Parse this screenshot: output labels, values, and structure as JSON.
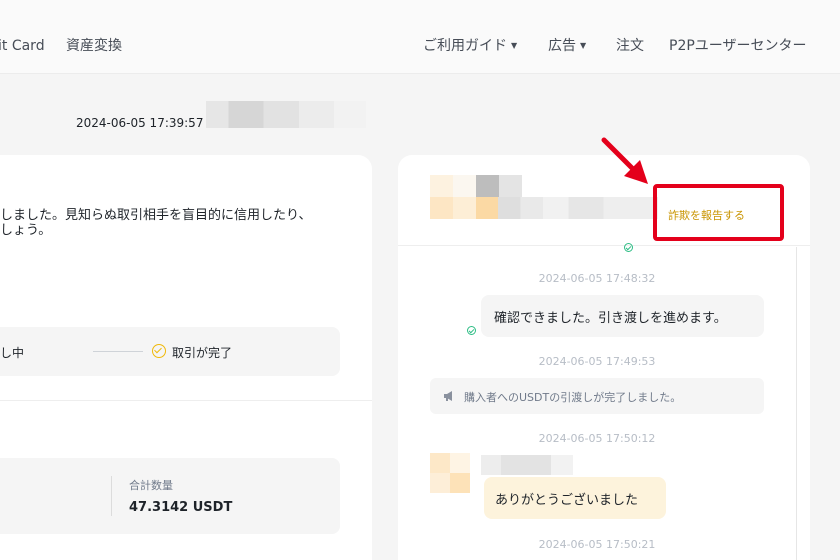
{
  "nav": {
    "items": [
      {
        "label": "it Card",
        "caret": false
      },
      {
        "label": "資産変換",
        "caret": false
      },
      {
        "label": "ご利用ガイド",
        "caret": true
      },
      {
        "label": "広告",
        "caret": true
      },
      {
        "label": "注文",
        "caret": false
      },
      {
        "label": "P2Pユーザーセンター",
        "caret": false
      }
    ],
    "caret_glyph": "▼"
  },
  "order": {
    "timestamp": "2024-06-05 17:39:57"
  },
  "left_panel": {
    "warning_line1": "しました。見知らぬ取引相手を盲目的に信用したり、",
    "warning_line2": "しょう。",
    "progress": {
      "step_partial": "し中",
      "step_done": "取引が完了"
    },
    "summary": {
      "total_label": "合計数量",
      "total_value": "47.3142 USDT"
    }
  },
  "chat": {
    "report_label": "詐欺を報告する",
    "messages": [
      {
        "time": "2024-06-05 17:48:32",
        "text": "確認できました。引き渡しを進めます。"
      },
      {
        "time": "2024-06-05 17:49:53",
        "system_text": "購入者へのUSDTの引渡しが完了しました。"
      },
      {
        "time": "2024-06-05 17:50:12",
        "text": "ありがとうございました"
      },
      {
        "time": "2024-06-05 17:50:21"
      }
    ]
  },
  "colors": {
    "accent": "#f0b90b",
    "report_text": "#c99400",
    "highlight_red": "#e4001b",
    "read_check": "#2ebd85"
  }
}
